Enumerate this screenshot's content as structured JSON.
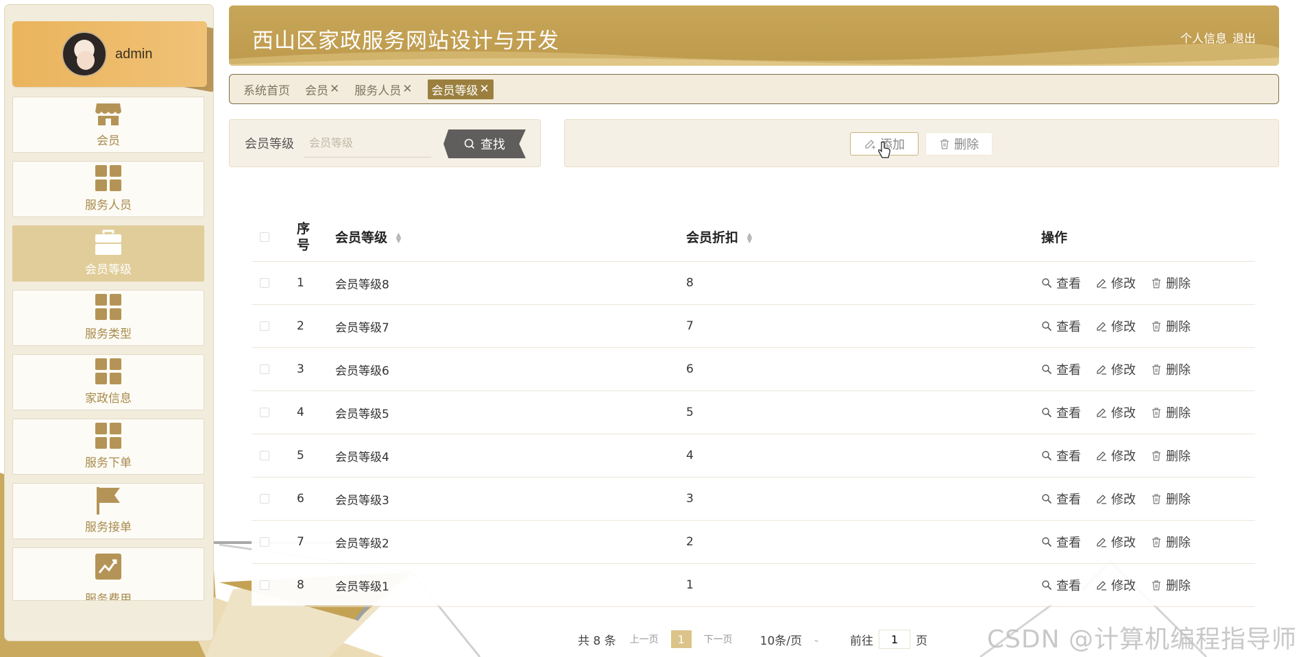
{
  "user": {
    "name": "admin"
  },
  "sidebar": {
    "items": [
      {
        "label": "会员",
        "icon": "shop-icon"
      },
      {
        "label": "服务人员",
        "icon": "grid-icon"
      },
      {
        "label": "会员等级",
        "icon": "briefcase-icon",
        "active": true
      },
      {
        "label": "服务类型",
        "icon": "grid-icon"
      },
      {
        "label": "家政信息",
        "icon": "grid-icon"
      },
      {
        "label": "服务下单",
        "icon": "grid-icon"
      },
      {
        "label": "服务接单",
        "icon": "flag-icon"
      },
      {
        "label": "服务费用",
        "icon": "chart-icon"
      }
    ]
  },
  "header": {
    "title": "西山区家政服务网站设计与开发",
    "profile_link": "个人信息",
    "logout_link": "退出"
  },
  "tabs": [
    {
      "label": "系统首页",
      "closable": false
    },
    {
      "label": "会员",
      "closable": true
    },
    {
      "label": "服务人员",
      "closable": true
    },
    {
      "label": "会员等级",
      "closable": true,
      "active": true
    }
  ],
  "close_glyph": "✕",
  "search": {
    "label": "会员等级",
    "placeholder": "会员等级",
    "button_label": "查找"
  },
  "actions": {
    "add_label": "添加",
    "delete_label": "删除"
  },
  "table": {
    "columns": {
      "index": "序号",
      "level": "会员等级",
      "discount": "会员折扣",
      "ops": "操作"
    },
    "op_labels": {
      "view": "查看",
      "edit": "修改",
      "delete": "删除"
    },
    "rows": [
      {
        "index": "1",
        "level": "会员等级8",
        "discount": "8"
      },
      {
        "index": "2",
        "level": "会员等级7",
        "discount": "7"
      },
      {
        "index": "3",
        "level": "会员等级6",
        "discount": "6"
      },
      {
        "index": "4",
        "level": "会员等级5",
        "discount": "5"
      },
      {
        "index": "5",
        "level": "会员等级4",
        "discount": "4"
      },
      {
        "index": "6",
        "level": "会员等级3",
        "discount": "3"
      },
      {
        "index": "7",
        "level": "会员等级2",
        "discount": "2"
      },
      {
        "index": "8",
        "level": "会员等级1",
        "discount": "1"
      }
    ]
  },
  "pagination": {
    "total": "共 8 条",
    "prev": "上一页",
    "current": "1",
    "next": "下一页",
    "page_size": "10条/页",
    "goto_prefix": "前往",
    "goto_value": "1",
    "goto_suffix": "页"
  },
  "watermark": "CSDN @计算机编程指导师",
  "colors": {
    "accent": "#c4a253",
    "active_menu": "#e0cd99",
    "active_tab": "#9a7f3e",
    "user_card": "#eab45c"
  }
}
